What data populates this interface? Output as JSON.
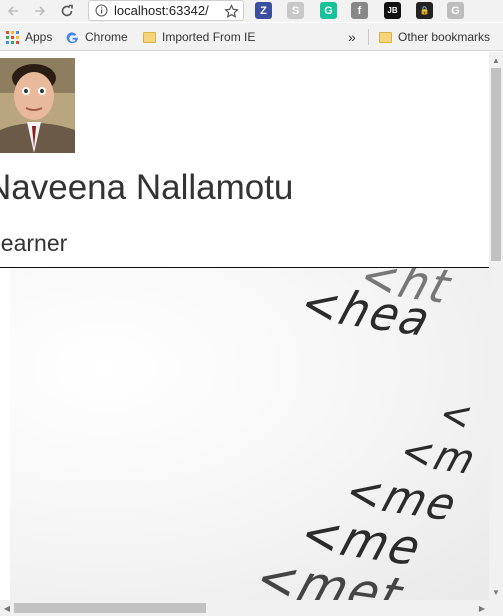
{
  "browser": {
    "url": "localhost:63342/",
    "bookmarks": {
      "apps_label": "Apps",
      "chrome_label": "Chrome",
      "imported_label": "Imported From IE",
      "overflow": "»",
      "other_label": "Other bookmarks"
    },
    "extensions": [
      {
        "name": "z-extension-icon",
        "color": "#3b4fa0",
        "glyph": "Z"
      },
      {
        "name": "skype-icon",
        "color": "#c8c8c8",
        "glyph": "S"
      },
      {
        "name": "grammarly-icon",
        "color": "#15c39a",
        "glyph": "G"
      },
      {
        "name": "feedly-icon",
        "color": "#888888",
        "glyph": "f"
      },
      {
        "name": "jetbrains-icon",
        "color": "#111111",
        "glyph": "JB"
      },
      {
        "name": "lock-extension-icon",
        "color": "#222222",
        "glyph": "🔒"
      },
      {
        "name": "g-extension-icon",
        "color": "#bdbdbd",
        "glyph": "G"
      }
    ]
  },
  "profile": {
    "name": "Naveena Nallamotu",
    "role": "Learner"
  },
  "hero": {
    "lines": [
      "<ht",
      "<hea",
      "<",
      "<m",
      "<me",
      "<me",
      "<met"
    ]
  }
}
